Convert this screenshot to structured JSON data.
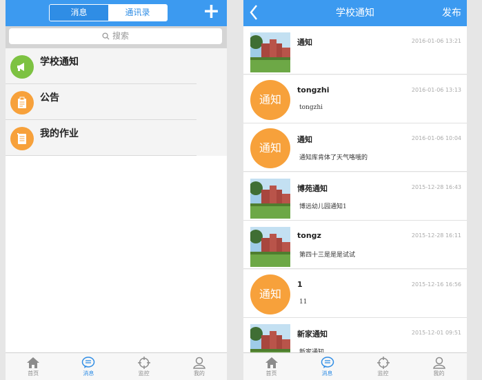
{
  "left": {
    "tabs": [
      "消息",
      "通讯录"
    ],
    "add_icon": "plus-icon",
    "search_placeholder": "搜索",
    "items": [
      {
        "label": "学校通知",
        "icon": "megaphone-icon",
        "color": "#7dc242"
      },
      {
        "label": "公告",
        "icon": "clipboard-icon",
        "color": "#f7a13b"
      },
      {
        "label": "我的作业",
        "icon": "notebook-icon",
        "color": "#f7a13b"
      }
    ]
  },
  "right": {
    "title": "学校通知",
    "publish": "发布",
    "notices": [
      {
        "title": "通知",
        "date": "2016-01-06 13:21",
        "body": "",
        "avatar": "photo"
      },
      {
        "title": "tongzhi",
        "date": "2016-01-06 13:13",
        "body": "tongzhi",
        "avatar": "badge"
      },
      {
        "title": "通知",
        "date": "2016-01-06 10:04",
        "body": "通知库肯体了天气咯哦的",
        "avatar": "badge"
      },
      {
        "title": "博苑通知",
        "date": "2015-12-28 16:43",
        "body": "博远幼儿园通知1",
        "avatar": "photo"
      },
      {
        "title": "tongz",
        "date": "2015-12-28 16:11",
        "body": "第四十三是是是试试",
        "avatar": "photo"
      },
      {
        "title": "1",
        "date": "2015-12-16 16:56",
        "body": "11",
        "avatar": "badge"
      },
      {
        "title": "新家通知",
        "date": "2015-12-01 09:51",
        "body": "新家通知",
        "avatar": "photo"
      }
    ],
    "badge_text": "通知"
  },
  "tabbar": [
    "首页",
    "消息",
    "监控",
    "我的"
  ],
  "colors": {
    "header": "#3c9af0",
    "accent": "#2f8de5",
    "badge": "#f7a13b"
  }
}
